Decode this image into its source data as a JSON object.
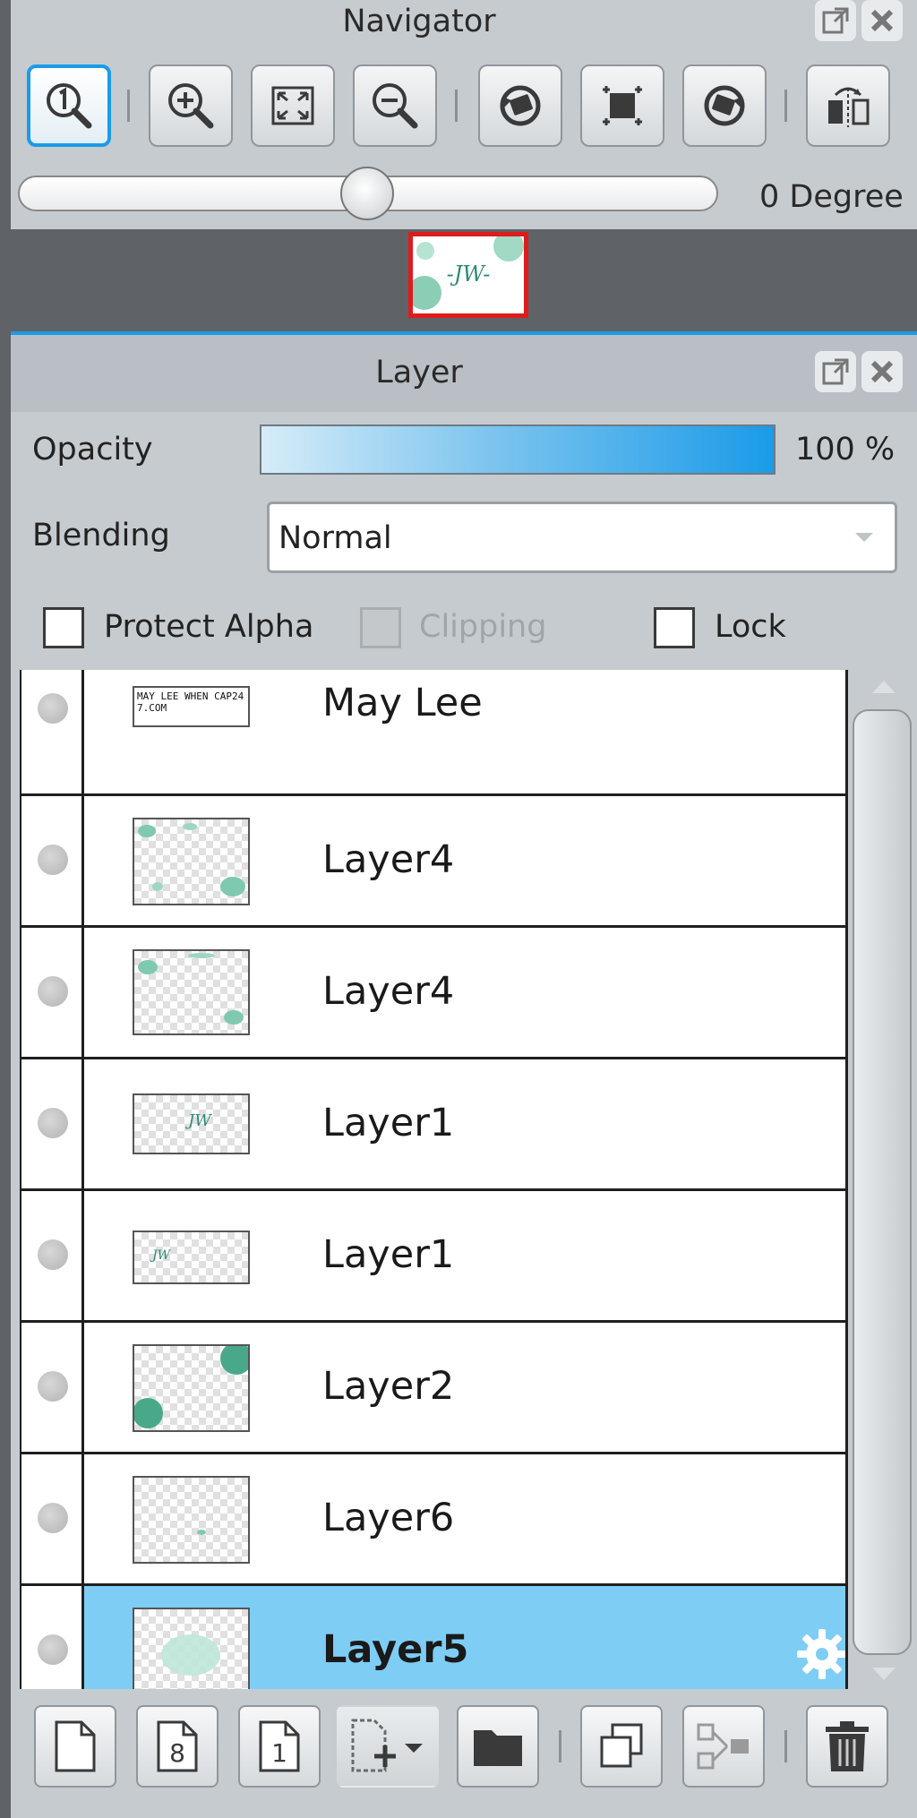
{
  "navigator": {
    "title": "Navigator",
    "rotation_label": "0 Degree",
    "zoom_slider_value": 0.5,
    "toolbar": [
      "actual-size",
      "zoom-in",
      "fit-to-screen",
      "zoom-out",
      "rotate-left",
      "reset-rotation",
      "rotate-right",
      "flip-horizontal"
    ],
    "preview_text": "-JW-"
  },
  "layer_panel": {
    "title": "Layer",
    "opacity_label": "Opacity",
    "opacity_value": "100 %",
    "blending_label": "Blending",
    "blending_value": "Normal",
    "protect_alpha_label": "Protect Alpha",
    "clipping_label": "Clipping",
    "lock_label": "Lock",
    "layers": [
      {
        "name": "May Lee",
        "thumb_text": "MAY LEE WHEN CAP247.COM"
      },
      {
        "name": "Layer4"
      },
      {
        "name": "Layer4"
      },
      {
        "name": "Layer1",
        "thumb_text": "JW"
      },
      {
        "name": "Layer1",
        "thumb_text": "JW"
      },
      {
        "name": "Layer2"
      },
      {
        "name": "Layer6"
      },
      {
        "name": "Layer5",
        "selected": true
      }
    ],
    "bottom_toolbar": [
      "new-color-layer",
      "new-8bit-layer",
      "new-1bit-layer",
      "add-layer-menu",
      "new-folder",
      "duplicate-layer",
      "merge-down",
      "delete-layer"
    ],
    "page_numbers": {
      "eight": "8",
      "one": "1"
    }
  },
  "colors": {
    "accent_blue": "#1a9be8",
    "selected_row": "#7ecdf5",
    "panel_bg": "#c6cbcf",
    "header_bg": "#b9bfc4"
  }
}
